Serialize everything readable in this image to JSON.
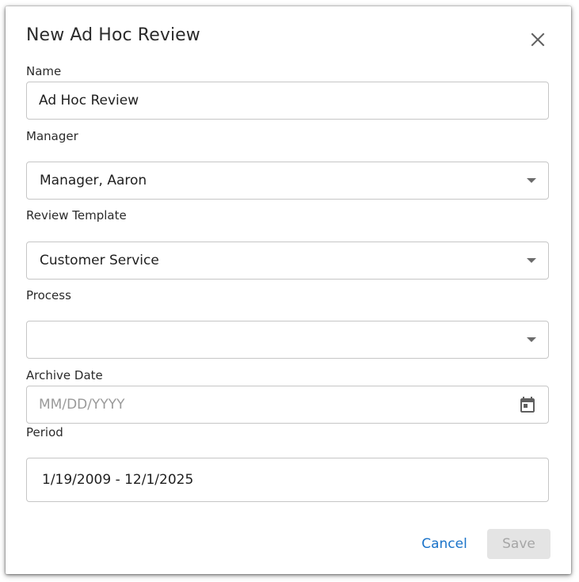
{
  "dialog": {
    "title": "New Ad Hoc Review",
    "close_icon": "close-icon"
  },
  "fields": {
    "name": {
      "label": "Name",
      "value": "Ad Hoc Review"
    },
    "manager": {
      "label": "Manager",
      "value": "Manager, Aaron"
    },
    "review_template": {
      "label": "Review Template",
      "value": "Customer Service"
    },
    "process": {
      "label": "Process",
      "value": ""
    },
    "archive_date": {
      "label": "Archive Date",
      "value": "",
      "placeholder": "MM/DD/YYYY",
      "icon": "calendar-icon"
    },
    "period": {
      "label": "Period",
      "value": "1/19/2009 - 12/1/2025"
    }
  },
  "actions": {
    "cancel_label": "Cancel",
    "save_label": "Save"
  },
  "colors": {
    "link": "#1a73c9",
    "border": "#c6c6c6",
    "disabled_bg": "#e4e4e4",
    "disabled_text": "#a6a6a6"
  }
}
